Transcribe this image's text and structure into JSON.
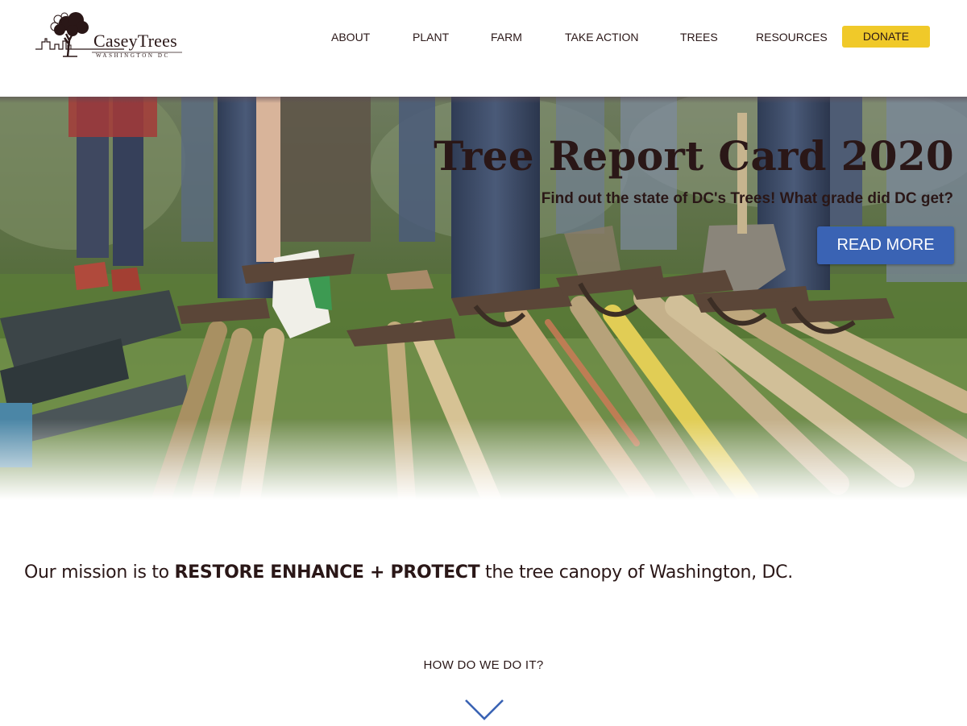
{
  "brand": {
    "name": "CaseyTrees",
    "location": "WASHINGTON DC",
    "logo_icon": "tree-skyline-logo"
  },
  "nav": {
    "items": [
      {
        "label": "ABOUT"
      },
      {
        "label": "PLANT"
      },
      {
        "label": "FARM"
      },
      {
        "label": "TAKE ACTION"
      },
      {
        "label": "TREES"
      },
      {
        "label": "RESOURCES"
      }
    ],
    "donate_label": "DONATE"
  },
  "hero": {
    "title": "Tree Report Card 2020",
    "subtitle": "Find out the state of DC's Trees! What grade did DC get?",
    "button_label": "READ MORE"
  },
  "mission": {
    "prefix": "Our mission is to ",
    "emphasis": "RESTORE ENHANCE + PROTECT",
    "suffix": " the tree canopy of Washington, DC."
  },
  "how": {
    "label": "HOW DO WE DO IT?",
    "arrow_icon": "chevron-down-icon"
  },
  "colors": {
    "text": "#2a1717",
    "donate": "#f0c929",
    "button": "#3a63b4",
    "arrow": "#3a63b4"
  }
}
